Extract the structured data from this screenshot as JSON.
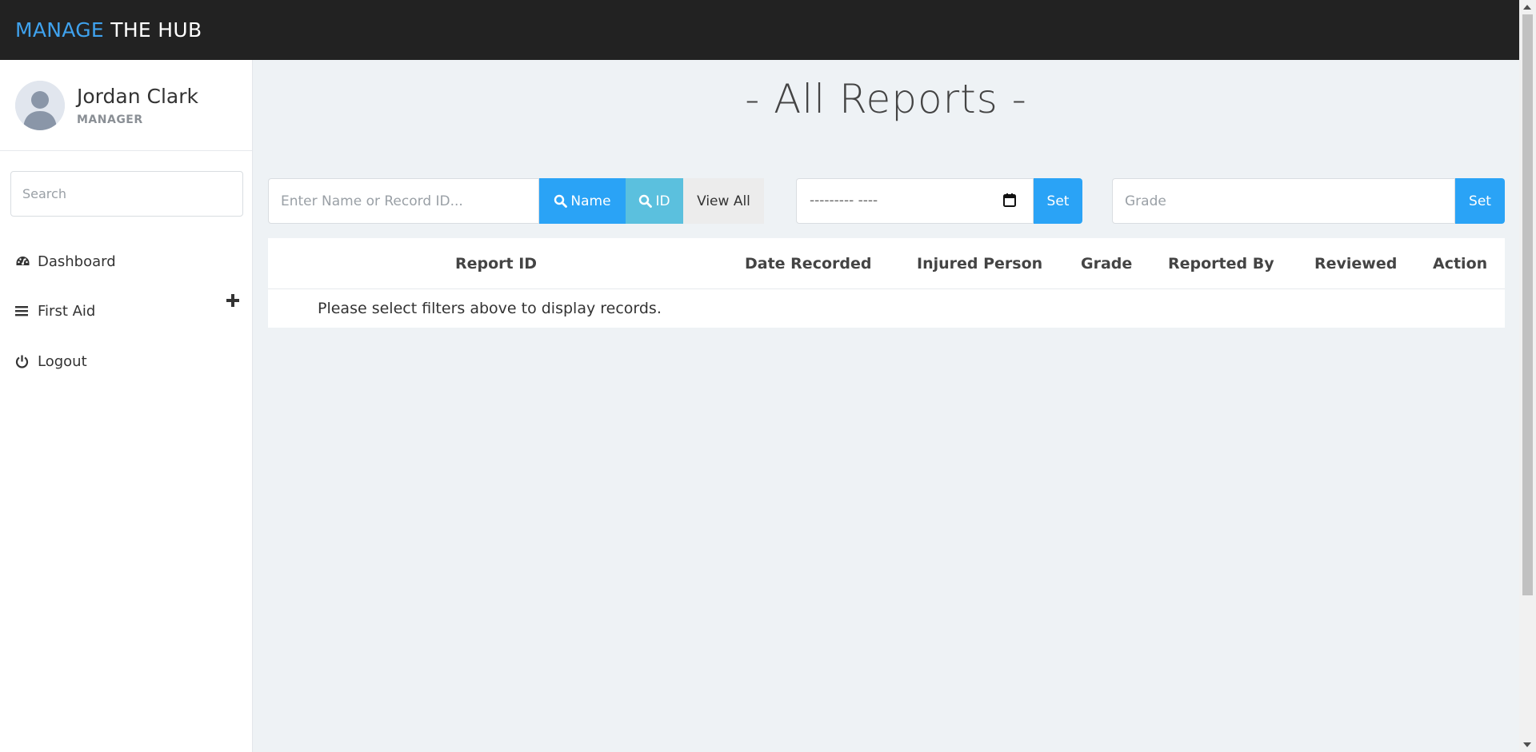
{
  "brand": {
    "part1": "MANAGE",
    "part2": "THE HUB",
    "accent_color": "#3fa2ee"
  },
  "user": {
    "name": "Jordan Clark",
    "role": "MANAGER"
  },
  "sidebar": {
    "search_placeholder": "Search",
    "items": [
      {
        "label": "Dashboard",
        "icon": "dashboard-icon"
      },
      {
        "label": "First Aid",
        "icon": "bars-icon",
        "action_icon": "plus-icon"
      },
      {
        "label": "Logout",
        "icon": "power-icon"
      }
    ]
  },
  "main": {
    "title": "- All Reports -",
    "search": {
      "placeholder": "Enter Name or Record ID...",
      "name_button": "Name",
      "id_button": "ID",
      "view_all_button": "View All"
    },
    "date_filter": {
      "value_display": "---------  ----",
      "set_button": "Set"
    },
    "grade_filter": {
      "placeholder": "Grade",
      "set_button": "Set"
    },
    "table": {
      "columns": [
        "Report ID",
        "Date Recorded",
        "Injured Person",
        "Grade",
        "Reported By",
        "Reviewed",
        "Action"
      ],
      "empty_message": "Please select filters above to display records."
    }
  },
  "colors": {
    "primary": "#2aa3f6",
    "info": "#5bc0de",
    "topbar": "#222222"
  }
}
